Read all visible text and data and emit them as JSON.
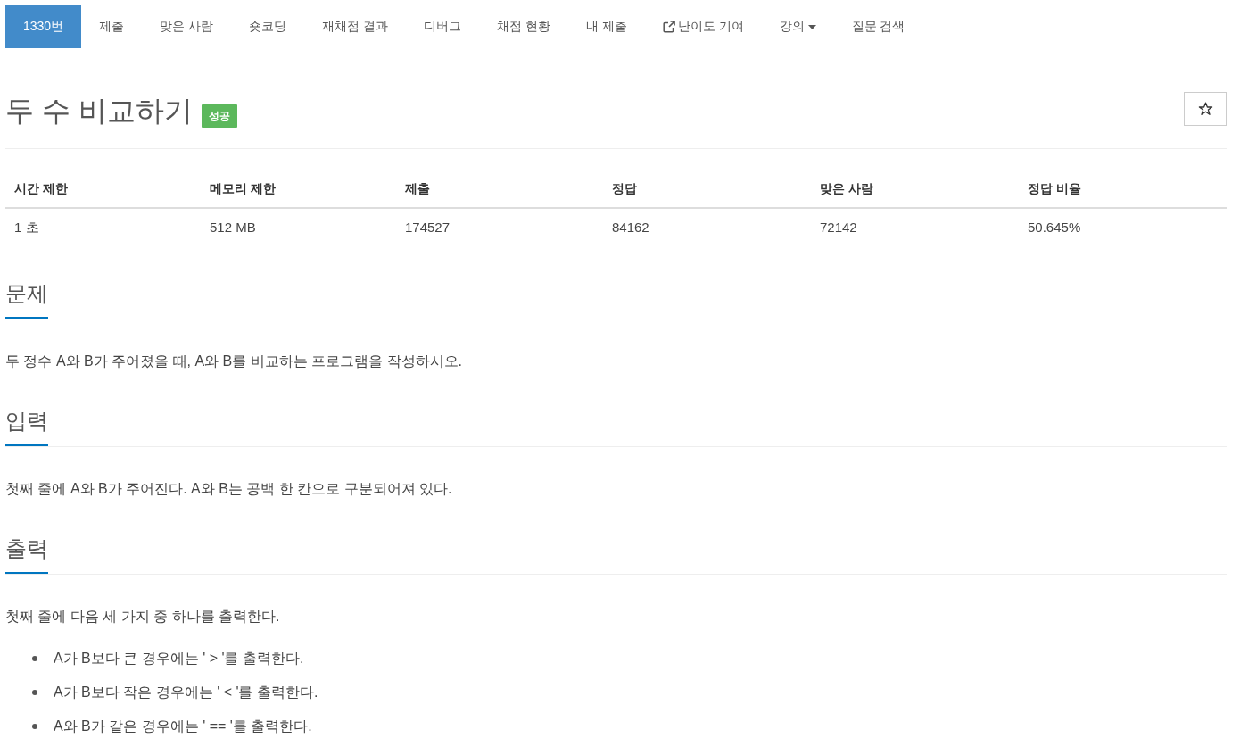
{
  "nav": {
    "tabs": [
      {
        "label": "1330번",
        "kind": "link",
        "selected": true
      },
      {
        "label": "제출",
        "kind": "link",
        "selected": false
      },
      {
        "label": "맞은 사람",
        "kind": "link",
        "selected": false
      },
      {
        "label": "숏코딩",
        "kind": "link",
        "selected": false
      },
      {
        "label": "재채점 결과",
        "kind": "link",
        "selected": false
      },
      {
        "label": "디버그",
        "kind": "link",
        "selected": false
      },
      {
        "label": "채점 현황",
        "kind": "link",
        "selected": false
      },
      {
        "label": "내 제출",
        "kind": "link",
        "selected": false
      },
      {
        "label": "난이도 기여",
        "kind": "external",
        "selected": false
      },
      {
        "label": "강의",
        "kind": "dropdown",
        "selected": false
      },
      {
        "label": "질문 검색",
        "kind": "link",
        "selected": false
      }
    ]
  },
  "problem": {
    "title": "두 수 비교하기",
    "badge": "성공"
  },
  "limits_table": {
    "columns": [
      "시간 제한",
      "메모리 제한",
      "제출",
      "정답",
      "맞은 사람",
      "정답 비율"
    ],
    "rows": [
      [
        "1 초",
        "512 MB",
        "174527",
        "84162",
        "72142",
        "50.645%"
      ]
    ]
  },
  "sections": [
    {
      "heading": "문제",
      "paragraphs": [
        "두 정수 A와 B가 주어졌을 때, A와 B를 비교하는 프로그램을 작성하시오."
      ]
    },
    {
      "heading": "입력",
      "paragraphs": [
        "첫째 줄에 A와 B가 주어진다. A와 B는 공백 한 칸으로 구분되어져 있다."
      ]
    },
    {
      "heading": "출력",
      "paragraphs": [
        "첫째 줄에 다음 세 가지 중 하나를 출력한다."
      ],
      "list": [
        "A가 B보다 큰 경우에는 ' > '를 출력한다.",
        "A가 B보다 작은 경우에는 ' < '를 출력한다.",
        "A와 B가 같은 경우에는 ' == '를 출력한다."
      ]
    }
  ]
}
